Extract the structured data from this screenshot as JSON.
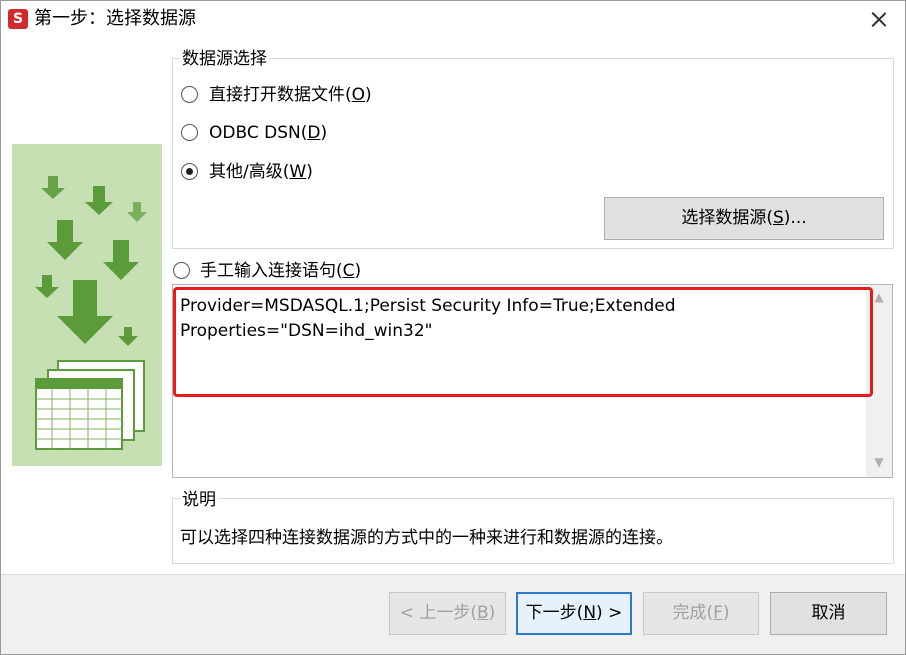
{
  "window": {
    "app_icon_letter": "S",
    "title": "第一步：选择数据源"
  },
  "data_source_group": {
    "legend": "数据源选择",
    "options": [
      {
        "label": "直接打开数据文件",
        "mnemonic": "O",
        "checked": false
      },
      {
        "label": "ODBC DSN",
        "mnemonic": "D",
        "checked": false
      },
      {
        "label": "其他/高级",
        "mnemonic": "W",
        "checked": true
      }
    ],
    "select_button": {
      "label": "选择数据源",
      "mnemonic": "S",
      "suffix": "..."
    }
  },
  "manual_option": {
    "label": "手工输入连接语句",
    "mnemonic": "C",
    "checked": false
  },
  "connection_string": "Provider=MSDASQL.1;Persist Security Info=True;Extended\nProperties=\"DSN=ihd_win32\"",
  "description": {
    "legend": "说明",
    "text": "可以选择四种连接数据源的方式中的一种来进行和数据源的连接。"
  },
  "footer": {
    "prev": {
      "prefix": "< ",
      "label": "上一步",
      "mnemonic": "B",
      "enabled": false
    },
    "next": {
      "label": "下一步",
      "mnemonic": "N",
      "suffix": " >",
      "enabled": true
    },
    "finish": {
      "label": "完成",
      "mnemonic": "F",
      "enabled": false
    },
    "cancel": {
      "label": "取消",
      "enabled": true
    }
  },
  "colors": {
    "illustration_bg": "#c6e0b4",
    "arrow_green": "#5b9b3a",
    "highlight_red": "#e81b1b",
    "focus_blue": "#2f78d0"
  }
}
